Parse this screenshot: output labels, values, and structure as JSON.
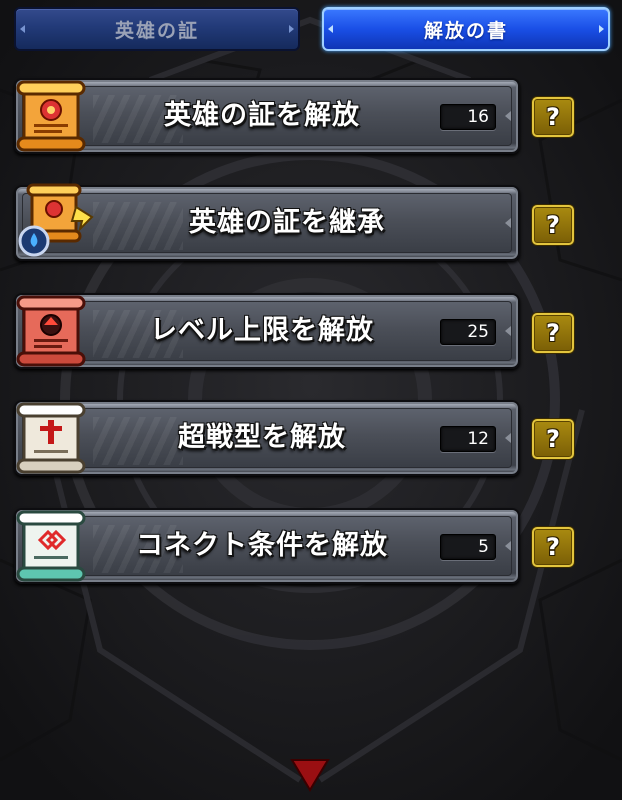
{
  "tabs": [
    {
      "label": "英雄の証",
      "active": false
    },
    {
      "label": "解放の書",
      "active": true
    }
  ],
  "rows": [
    {
      "title": "英雄の証を解放",
      "count": "16",
      "icon": "orange-scroll-icon"
    },
    {
      "title": "英雄の証を継承",
      "count": null,
      "icon": "inherit-scroll-icon"
    },
    {
      "title": "レベル上限を解放",
      "count": "25",
      "icon": "red-scroll-icon"
    },
    {
      "title": "超戦型を解放",
      "count": "12",
      "icon": "white-scroll-icon"
    },
    {
      "title": "コネクト条件を解放",
      "count": "5",
      "icon": "teal-scroll-icon"
    }
  ],
  "help_label": "?",
  "colors": {
    "active_tab": "#1a4fe6",
    "inactive_tab": "#223a78",
    "help_button": "#8c6f0a",
    "background": "#1b1b1e"
  }
}
